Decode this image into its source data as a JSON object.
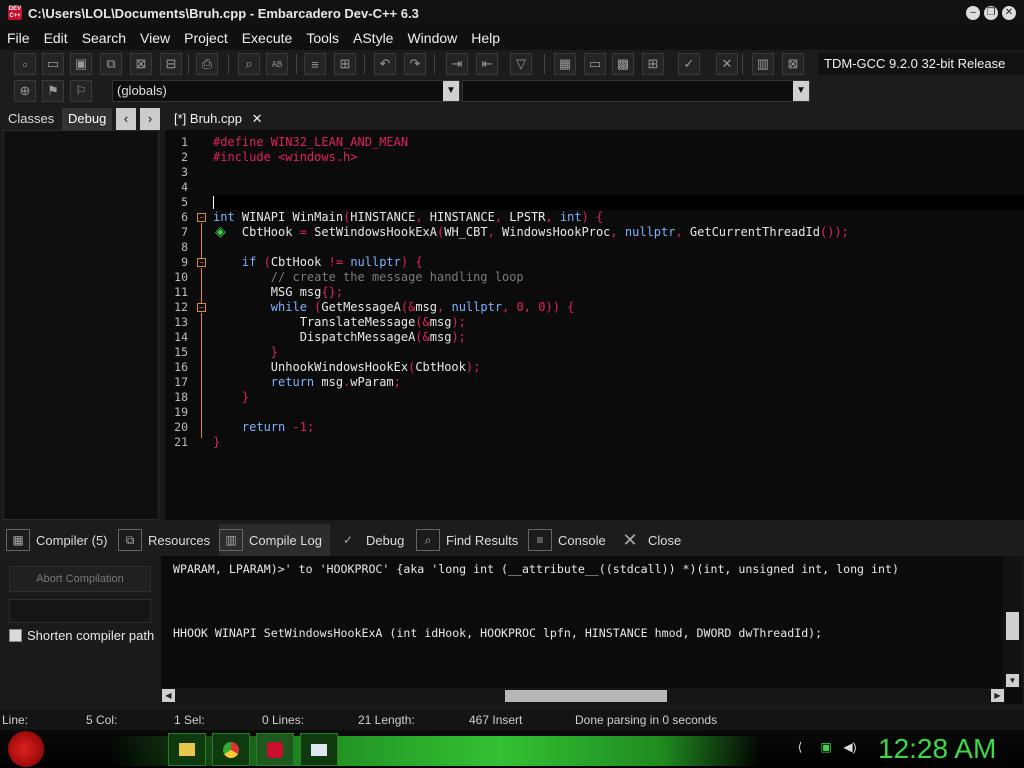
{
  "window": {
    "title": "C:\\Users\\LOL\\Documents\\Bruh.cpp - Embarcadero Dev-C++ 6.3",
    "icon_text": "DEV C++"
  },
  "menu": [
    "File",
    "Edit",
    "Search",
    "View",
    "Project",
    "Execute",
    "Tools",
    "AStyle",
    "Window",
    "Help"
  ],
  "toolbar": {
    "compiler": "TDM-GCC 9.2.0 32-bit Release",
    "scope": "(globals)",
    "function": ""
  },
  "left_panel": {
    "tabs": [
      "Classes",
      "Debug"
    ],
    "active": "Debug"
  },
  "editor": {
    "tab_label": "[*] Bruh.cpp",
    "line_numbers": [
      "1",
      "2",
      "3",
      "4",
      "5",
      "6",
      "7",
      "8",
      "9",
      "10",
      "11",
      "12",
      "13",
      "14",
      "15",
      "16",
      "17",
      "18",
      "19",
      "20",
      "21"
    ]
  },
  "bottom_tabs": [
    {
      "label": "Compiler (5)",
      "icon": "grid-icon"
    },
    {
      "label": "Resources",
      "icon": "resources-icon"
    },
    {
      "label": "Compile Log",
      "icon": "bar-chart-icon"
    },
    {
      "label": "Debug",
      "icon": "check-icon"
    },
    {
      "label": "Find Results",
      "icon": "find-icon"
    },
    {
      "label": "Console",
      "icon": "console-icon"
    },
    {
      "label": "Close",
      "icon": "close-icon"
    }
  ],
  "compile_panel": {
    "abort_label": "Abort Compilation",
    "shorten_label": "Shorten compiler path",
    "shorten_checked": false
  },
  "log": {
    "line1": "WPARAM, LPARAM)>' to 'HOOKPROC' {aka 'long int (__attribute__((stdcall)) *)(int, unsigned int, long int)",
    "line2": "HHOOK WINAPI SetWindowsHookExA (int idHook, HOOKPROC lpfn, HINSTANCE hmod, DWORD dwThreadId);"
  },
  "status": {
    "line": "Line:",
    "col": "5 Col:",
    "sel": "1 Sel:",
    "lines": "0 Lines:",
    "length": "21 Length:",
    "insert": "467 Insert",
    "message": "Done parsing in 0 seconds"
  },
  "taskbar": {
    "clock": "12:28 AM"
  },
  "colors": {
    "keyword": "#7fb0ff",
    "preprocessor": "#e0215e",
    "comment": "#7a7a7a",
    "accent_green": "#3cd84a"
  }
}
